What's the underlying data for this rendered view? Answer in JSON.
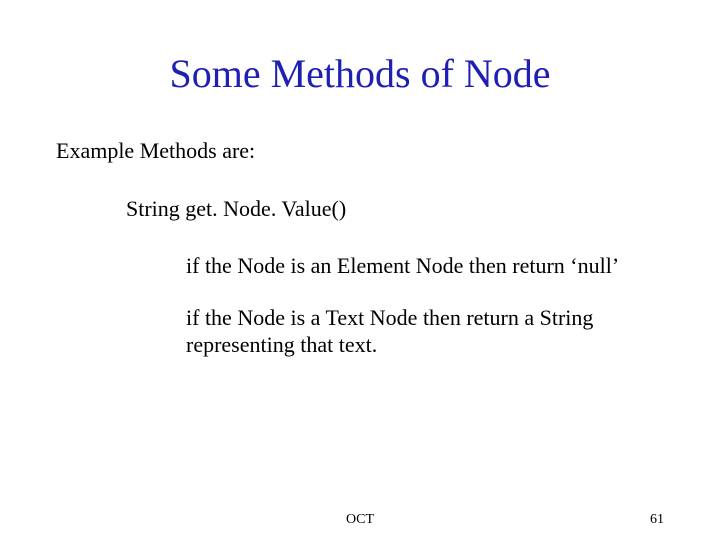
{
  "title": "Some Methods of Node",
  "lines": {
    "intro": "Example Methods are:",
    "method": "String get. Node. Value()",
    "desc1": "if the Node is an Element Node then return ‘null’",
    "desc2": "if the Node is a Text Node then return a String representing that text."
  },
  "footer": {
    "center": "OCT",
    "page": "61"
  }
}
